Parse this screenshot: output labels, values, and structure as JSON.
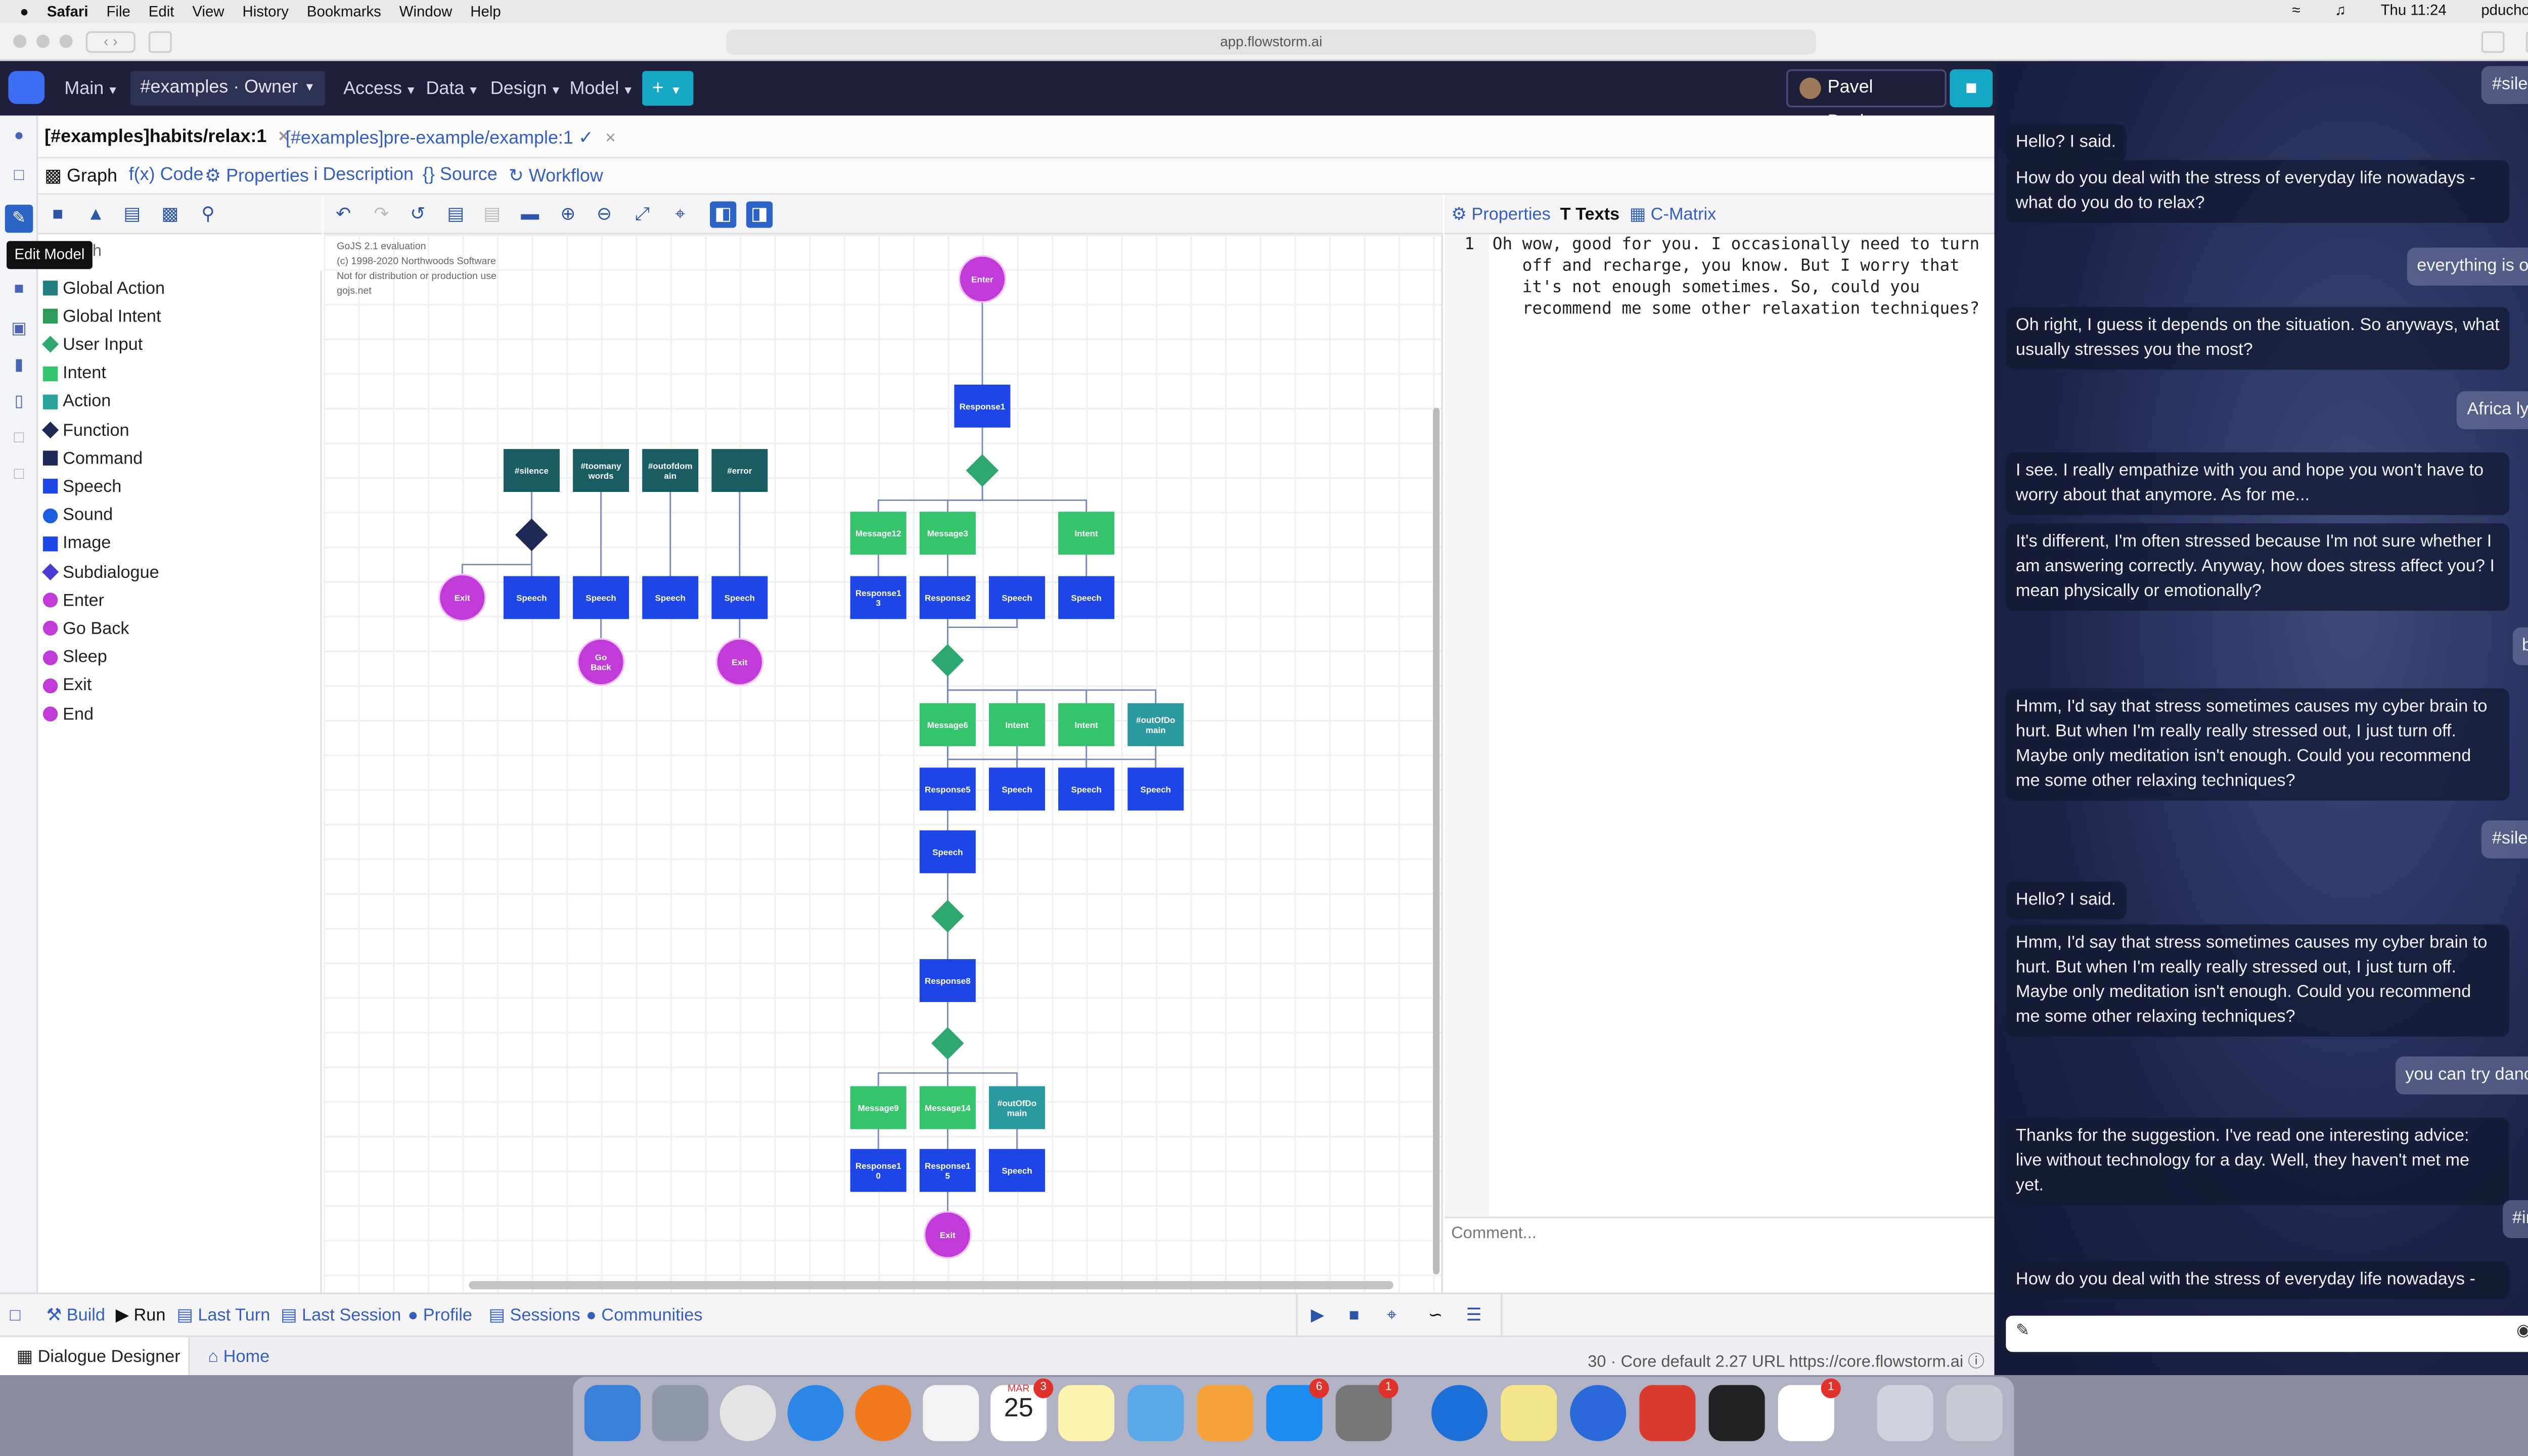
{
  "menubar": {
    "apple": "",
    "app": "Safari",
    "items": [
      "File",
      "Edit",
      "View",
      "History",
      "Bookmarks",
      "Window",
      "Help"
    ],
    "time": "Thu 11:24",
    "user": "pducho"
  },
  "browser": {
    "url": "app.flowstorm.ai"
  },
  "nav": {
    "main": "Main",
    "workspace": "#examples · Owner",
    "access": "Access",
    "data": "Data",
    "design": "Design",
    "model": "Model",
    "plus": "+",
    "user": "Pavel Ducho"
  },
  "filetabs": [
    {
      "label": "[#examples]habits/relax:1",
      "close": "×"
    },
    {
      "label": "[#examples]pre-example/example:1 ✓",
      "close": "×"
    }
  ],
  "viewtabs": [
    "Graph",
    "Code",
    "Properties",
    "Description",
    "Source",
    "Workflow"
  ],
  "tooltip": "Edit Model",
  "search_placeholder": "h",
  "palette": [
    {
      "label": "Global Action",
      "color": "#227e80",
      "shape": "square"
    },
    {
      "label": "Global Intent",
      "color": "#2e9a5a",
      "shape": "square"
    },
    {
      "label": "User Input",
      "color": "#2fa870",
      "shape": "diamond"
    },
    {
      "label": "Intent",
      "color": "#35c46b",
      "shape": "square"
    },
    {
      "label": "Action",
      "color": "#2aa39a",
      "shape": "square"
    },
    {
      "label": "Function",
      "color": "#1e2a55",
      "shape": "diamond"
    },
    {
      "label": "Command",
      "color": "#1e2a55",
      "shape": "square"
    },
    {
      "label": "Speech",
      "color": "#1e46e6",
      "shape": "square"
    },
    {
      "label": "Sound",
      "color": "#1b5fe0",
      "shape": "circle"
    },
    {
      "label": "Image",
      "color": "#1e46e6",
      "shape": "square"
    },
    {
      "label": "Subdialogue",
      "color": "#4a3ad6",
      "shape": "diamond"
    },
    {
      "label": "Enter",
      "color": "#c03ad8",
      "shape": "circle"
    },
    {
      "label": "Go Back",
      "color": "#c03ad8",
      "shape": "circle"
    },
    {
      "label": "Sleep",
      "color": "#c03ad8",
      "shape": "circle"
    },
    {
      "label": "Exit",
      "color": "#c03ad8",
      "shape": "circle"
    },
    {
      "label": "End",
      "color": "#c03ad8",
      "shape": "circle"
    }
  ],
  "gojs": [
    "GoJS 2.1 evaluation",
    "(c) 1998-2020 Northwoods Software",
    "Not for distribution or production use",
    "gojs.net"
  ],
  "diagram": {
    "nodes": [
      {
        "id": "enter",
        "type": "enter",
        "label": "Enter"
      },
      {
        "id": "r1",
        "type": "speech",
        "label": "Response1"
      },
      {
        "id": "d1",
        "type": "input"
      },
      {
        "id": "m12",
        "type": "intent",
        "label": "Message12"
      },
      {
        "id": "m3",
        "type": "intent",
        "label": "Message3"
      },
      {
        "id": "i1",
        "type": "intent",
        "label": "Intent"
      },
      {
        "id": "r13",
        "type": "speech",
        "label": "Response1\n3"
      },
      {
        "id": "r2",
        "type": "speech",
        "label": "Response2"
      },
      {
        "id": "s1",
        "type": "speech",
        "label": "Speech"
      },
      {
        "id": "s2",
        "type": "speech",
        "label": "Speech"
      },
      {
        "id": "d2",
        "type": "input"
      },
      {
        "id": "m6",
        "type": "intent",
        "label": "Message6"
      },
      {
        "id": "i2",
        "type": "intent",
        "label": "Intent"
      },
      {
        "id": "i3",
        "type": "intent",
        "label": "Intent"
      },
      {
        "id": "ood1",
        "type": "action",
        "label": "#outOfDo\nmain"
      },
      {
        "id": "r5",
        "type": "speech",
        "label": "Response5"
      },
      {
        "id": "s3",
        "type": "speech",
        "label": "Speech"
      },
      {
        "id": "s4",
        "type": "speech",
        "label": "Speech"
      },
      {
        "id": "s5",
        "type": "speech",
        "label": "Speech"
      },
      {
        "id": "s6",
        "type": "speech",
        "label": "Speech"
      },
      {
        "id": "d3",
        "type": "input"
      },
      {
        "id": "r8",
        "type": "speech",
        "label": "Response8"
      },
      {
        "id": "d4",
        "type": "input"
      },
      {
        "id": "m9",
        "type": "intent",
        "label": "Message9"
      },
      {
        "id": "m14",
        "type": "intent",
        "label": "Message14"
      },
      {
        "id": "ood2",
        "type": "action",
        "label": "#outOfDo\nmain"
      },
      {
        "id": "r10",
        "type": "speech",
        "label": "Response1\n0"
      },
      {
        "id": "r15",
        "type": "speech",
        "label": "Response1\n5"
      },
      {
        "id": "s7",
        "type": "speech",
        "label": "Speech"
      },
      {
        "id": "exit2",
        "type": "enter",
        "label": "Exit"
      },
      {
        "id": "g1",
        "type": "global",
        "label": "#silence"
      },
      {
        "id": "g2",
        "type": "global",
        "label": "#toomany\nwords"
      },
      {
        "id": "g3",
        "type": "global",
        "label": "#outofdom\nain"
      },
      {
        "id": "g4",
        "type": "global",
        "label": "#error"
      },
      {
        "id": "fn",
        "type": "function"
      },
      {
        "id": "exit1",
        "type": "enter",
        "label": "Exit"
      },
      {
        "id": "gs1",
        "type": "speech",
        "label": "Speech"
      },
      {
        "id": "gs2",
        "type": "speech",
        "label": "Speech"
      },
      {
        "id": "gs3",
        "type": "speech",
        "label": "Speech"
      },
      {
        "id": "gs4",
        "type": "speech",
        "label": "Speech"
      },
      {
        "id": "goback",
        "type": "enter",
        "label": "Go\nBack"
      },
      {
        "id": "exit3",
        "type": "enter",
        "label": "Exit"
      }
    ]
  },
  "rtabs": [
    "Properties",
    "Texts",
    "C-Matrix"
  ],
  "editor": {
    "line": "1",
    "text": "Oh wow, good for you. I occasionally need to turn\n   off and recharge, you know. But I worry that\n   it's not enough sometimes. So, could you\n   recommend me some other relaxation techniques?",
    "comment_placeholder": "Comment..."
  },
  "btabs": [
    "Build",
    "Run",
    "Last Turn",
    "Last Session",
    "Profile",
    "Sessions",
    "Communities"
  ],
  "status": {
    "left": "Dialogue Designer",
    "home": "Home",
    "right": "30 · Core default 2.27 URL https://core.flowstorm.ai"
  },
  "chat": [
    {
      "who": "user",
      "text": "#silence"
    },
    {
      "who": "bot",
      "text": "Hello? I said."
    },
    {
      "who": "bot",
      "text": "How do you deal with the stress of everyday life nowadays - what do you do to relax?"
    },
    {
      "who": "user",
      "text": "everything is okay"
    },
    {
      "who": "bot",
      "text": "Oh right, I guess it depends on the situation. So anyways, what usually stresses you the most?"
    },
    {
      "who": "user",
      "text": "Africa lyrics"
    },
    {
      "who": "bot",
      "text": "I see. I really empathize with you and hope you won't have to worry about that anymore. As for me..."
    },
    {
      "who": "bot",
      "text": "It's different, I'm often stressed because I'm not sure whether I am answering correctly. Anyway, how does stress affect you? I mean physically or emotionally?"
    },
    {
      "who": "user",
      "text": "both"
    },
    {
      "who": "bot",
      "text": "Hmm, I'd say that stress sometimes causes my cyber brain to hurt. But when I'm really really stressed out, I just turn off. Maybe only meditation isn't enough. Could you recommend me some other relaxing techniques?"
    },
    {
      "who": "user",
      "text": "#silence"
    },
    {
      "who": "bot",
      "text": "Hello? I said."
    },
    {
      "who": "bot",
      "text": "Hmm, I'd say that stress sometimes causes my cyber brain to hurt. But when I'm really really stressed out, I just turn off. Maybe only meditation isn't enough. Could you recommend me some other relaxing techniques?"
    },
    {
      "who": "user",
      "text": "you can try dancing"
    },
    {
      "who": "bot",
      "text": "Thanks for the suggestion. I've read one interesting advice: live without technology for a day. Well, they haven't met me yet."
    },
    {
      "who": "user",
      "text": "#intro"
    },
    {
      "who": "bot",
      "text": "How do you deal with the stress of everyday life nowadays -"
    }
  ],
  "dock": {
    "calendar_month": "MAR",
    "calendar_day": "25",
    "badges": [
      "3",
      "6",
      "1",
      "1"
    ]
  },
  "colors": {
    "nav": "#1e1f3a",
    "accent": "#17a7c7",
    "speech": "#1e46e6",
    "intent": "#35c46b",
    "global": "#1a5c63",
    "enter": "#c03ad8",
    "input": "#2fa870"
  }
}
